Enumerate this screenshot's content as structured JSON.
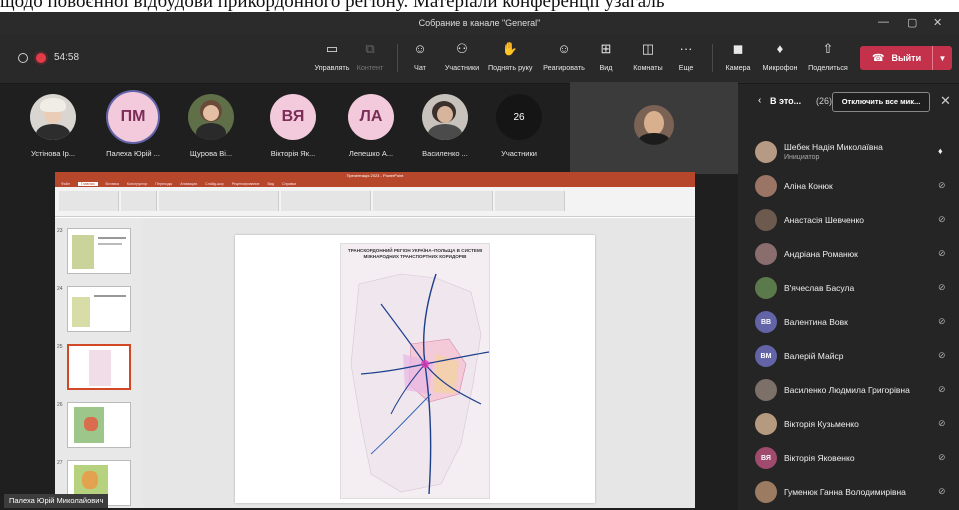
{
  "caption_above": "щодо повоєнної відбудови прикордонного регіону. Матеріали конференції узагаль",
  "window": {
    "title": "Собрание в канале \"General\""
  },
  "meeting": {
    "timer": "54:58"
  },
  "toolbar": {
    "manage": "Управлять",
    "content": "Контент",
    "chat": "Чат",
    "participants": "Участники",
    "raise_hand": "Поднять руку",
    "react": "Реагировать",
    "view": "Вид",
    "rooms": "Комнаты",
    "more": "Еще",
    "camera": "Камера",
    "mic": "Микрофон",
    "share": "Поделиться",
    "leave": "Выйти"
  },
  "gallery": {
    "tiles": [
      {
        "name": "Устінова Ір...",
        "initials": "",
        "icon": "photo"
      },
      {
        "name": "Палеха Юрій ...",
        "initials": "ПМ",
        "icon": "initials"
      },
      {
        "name": "Щурова Ві...",
        "initials": "",
        "icon": "photo"
      },
      {
        "name": "Вікторія Як...",
        "initials": "ВЯ",
        "icon": "initials"
      },
      {
        "name": "Лепешко А...",
        "initials": "ЛА",
        "icon": "initials"
      },
      {
        "name": "Василенко ...",
        "initials": "",
        "icon": "photo"
      }
    ],
    "overflow": {
      "count": "26",
      "label": "Участники"
    }
  },
  "shared_screen": {
    "app": "PowerPoint",
    "window_title": "Презентація 2023 - PowerPoint",
    "tabs": [
      "Файл",
      "Главная",
      "Вставка",
      "Конструктор",
      "Переходы",
      "Анимация",
      "Слайд-шоу",
      "Рецензирование",
      "Вид",
      "Справка"
    ],
    "active_tab": "Главная",
    "slide_numbers": [
      "23",
      "24",
      "25",
      "26",
      "27"
    ],
    "selected_slide": "25",
    "slide_title": "ТРАНСКОРДОННИЙ РЕГІОН УКРАЇНА–ПОЛЬЩА В СИСТЕМІ МІЖНАРОДНИХ ТРАНСПОРТНИХ КОРИДОРІВ"
  },
  "presenter_label": "Палеха Юрій Миколайович",
  "panel": {
    "title": "В это...",
    "count": "(26)",
    "mute_all": "Отключить все мик...",
    "people": [
      {
        "name": "Шебек Надія Миколаївна",
        "role": "Инициатор",
        "initials": "",
        "mic": "on"
      },
      {
        "name": "Аліна Конюк",
        "role": "",
        "initials": "",
        "mic": "off"
      },
      {
        "name": "Анастасія Шевченко",
        "role": "",
        "initials": "",
        "mic": "off"
      },
      {
        "name": "Андріана Романюк",
        "role": "",
        "initials": "",
        "mic": "off"
      },
      {
        "name": "В'ячеслав Басула",
        "role": "",
        "initials": "",
        "mic": "off"
      },
      {
        "name": "Валентина Вовк",
        "role": "",
        "initials": "ВВ",
        "mic": "off"
      },
      {
        "name": "Валерій Майср",
        "role": "",
        "initials": "ВМ",
        "mic": "off"
      },
      {
        "name": "Василенко Людмила Григорівна",
        "role": "",
        "initials": "",
        "mic": "off"
      },
      {
        "name": "Вікторія Кузьменко",
        "role": "",
        "initials": "",
        "mic": "off"
      },
      {
        "name": "Вікторія Яковенко",
        "role": "",
        "initials": "ВЯ",
        "mic": "off"
      },
      {
        "name": "Гуменюк Ганна Володимирівна",
        "role": "",
        "initials": "",
        "mic": "off"
      }
    ]
  },
  "colors": {
    "accent": "#6264a7",
    "leave": "#c4314b",
    "record": "#e43b48",
    "ppt": "#b7472a",
    "avatar_pink": "#f3c9dc"
  }
}
